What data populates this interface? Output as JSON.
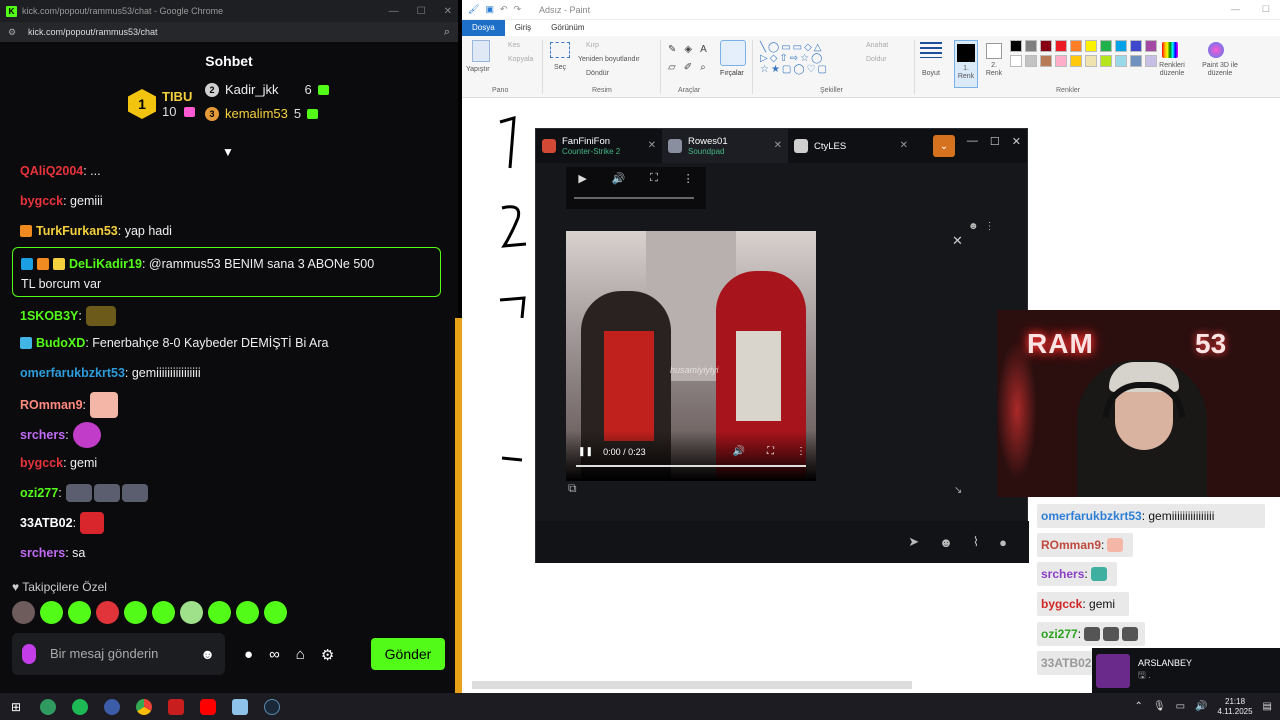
{
  "chrome": {
    "window_title": "kick.com/popout/rammus53/chat - Google Chrome",
    "url": "kick.com/popout/rammus53/chat",
    "chat_title": "Sohbet",
    "leaderboard": {
      "first": {
        "rank": "1",
        "name": "TIBU",
        "count": "10"
      },
      "second": {
        "rank": "2",
        "name": "Kadir_jkk",
        "count": "6"
      },
      "third": {
        "rank": "3",
        "name": "kemalim53",
        "count": "5"
      }
    },
    "messages": [
      {
        "user": "QAliQ2004",
        "text": ": ...",
        "color": "#e8333d"
      },
      {
        "user": "bygcck",
        "text": ": gemiii",
        "color": "#e8333d"
      },
      {
        "user": "TurkFurkan53",
        "text": ": yap hadi",
        "color": "#f4d03f"
      },
      {
        "user": "1SKOB3Y",
        "text": ":",
        "color": "#53fc18"
      },
      {
        "user": "BudoXD",
        "text": ": Fenerbahçe 8-0 Kaybeder DEMİŞTİ Bi Ara",
        "color": "#53fc18"
      },
      {
        "user": "omerfarukbzkrt53",
        "text": ": gemiiiiiiiiiiiiiiii",
        "color": "#2d9cdb"
      },
      {
        "user": "ROmman9",
        "text": ":",
        "color": "#ff8a80"
      },
      {
        "user": "srchers",
        "text": ":",
        "color": "#c06cf5"
      },
      {
        "user": "bygcck",
        "text": ": gemi",
        "color": "#e8333d"
      },
      {
        "user": "ozi277",
        "text": ":",
        "color": "#53fc18"
      },
      {
        "user": "33ATB02",
        "text": ":",
        "color": "#ffffff"
      },
      {
        "user": "srchers",
        "text": ": sa",
        "color": "#c06cf5"
      }
    ],
    "highlight": {
      "user": "DeLiKadir19",
      "text": ": @rammus53 BENIM sana 3 ABONe 500",
      "line2": "TL borcum var"
    },
    "followers_label": "♥ Takipçilere Özel",
    "input_placeholder": "Bir mesaj gönderin",
    "send_label": "Gönder"
  },
  "paint": {
    "title": "Adsız - Paint",
    "tabs": [
      "Dosya",
      "Giriş",
      "Görünüm"
    ],
    "groups": [
      "Pano",
      "Resim",
      "Araçlar",
      "Şekiller",
      "Renkler"
    ],
    "labels": {
      "paste": "Yapıştır",
      "cut": "Kes",
      "copy": "Kopyala",
      "select": "Seç",
      "crop": "Kırp",
      "resize": "Yeniden boyutlandır",
      "rotate": "Döndür",
      "brushes": "Fırçalar",
      "outline": "Anahat",
      "fill": "Doldur",
      "size": "Boyut",
      "color1": "1. Renk",
      "color2": "2. Renk",
      "edit_colors": "Renkleri düzenle",
      "paint3d": "Paint 3D ile düzenle"
    },
    "palette": [
      "#000000",
      "#7f7f7f",
      "#880015",
      "#ed1c24",
      "#ff7f27",
      "#fff200",
      "#22b14c",
      "#00a2e8",
      "#3f48cc",
      "#a349a4",
      "#ffffff",
      "#c3c3c3",
      "#b97a57",
      "#ffaec9",
      "#ffc90e",
      "#efe4b0",
      "#b5e61d",
      "#99d9ea",
      "#7092be",
      "#c8bfe7"
    ]
  },
  "overlay": {
    "tabs": [
      {
        "title": "FanFiniFon",
        "subtitle": "Counter-Strike 2"
      },
      {
        "title": "Rowes01",
        "subtitle": "Soundpad"
      },
      {
        "title": "CtyLES",
        "subtitle": ""
      }
    ],
    "video_time": "0:00 / 0:23",
    "watermark": "husamiyiyiyi"
  },
  "stream_chat": [
    {
      "user": "omerfarukbzkrt53",
      "text": ": gemiiiiiiiiiiiiiiii",
      "color": "#2d7fd6"
    },
    {
      "user": "ROmman9",
      "text": ":",
      "color": "#c04a3f"
    },
    {
      "user": "srchers",
      "text": ":",
      "color": "#8a3fc7"
    },
    {
      "user": "bygcck",
      "text": ": gemi",
      "color": "#d12525"
    },
    {
      "user": "ozi277",
      "text": ":",
      "color": "#2aa31d"
    },
    {
      "user": "33ATB02",
      "text": "",
      "color": "#999999"
    }
  ],
  "notification": {
    "name": "ARSLANBEY",
    "sub": "🖫 ."
  },
  "taskbar": {
    "time": "21:18",
    "date": "4.11.2025"
  }
}
